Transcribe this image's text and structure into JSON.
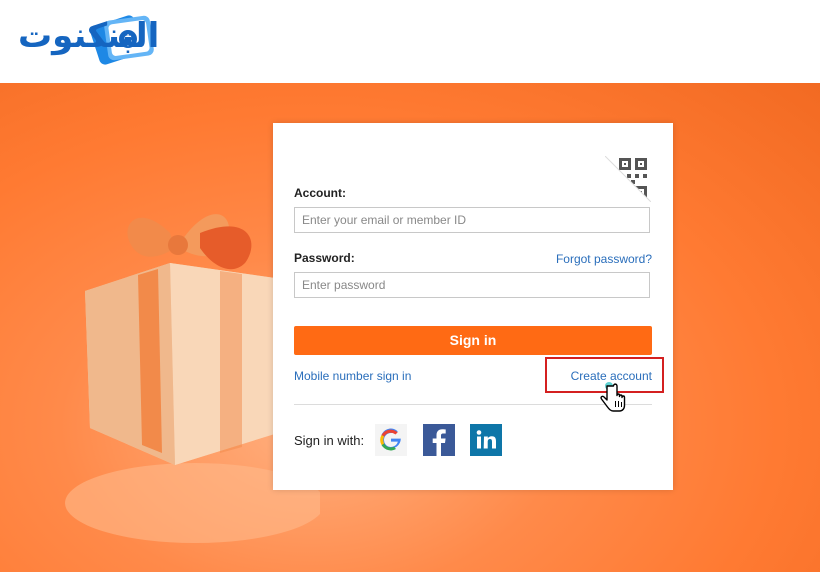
{
  "brand": {
    "logo_text": "البنكنوت",
    "logo_symbol": "$",
    "primary_color": "#1565c0"
  },
  "login": {
    "account_label": "Account:",
    "account_placeholder": "Enter your email or member ID",
    "password_label": "Password:",
    "forgot_password": "Forgot password?",
    "password_placeholder": "Enter password",
    "sign_in_button": "Sign in",
    "mobile_sign_in": "Mobile number sign in",
    "create_account": "Create account",
    "sign_in_with": "Sign in with:",
    "qr_icon": "qr-code-icon"
  },
  "social": [
    {
      "name": "google",
      "glyph": "G"
    },
    {
      "name": "facebook",
      "glyph": "f"
    },
    {
      "name": "linkedin",
      "glyph": "in"
    }
  ],
  "colors": {
    "accent": "#ff6a14",
    "link": "#2a6ebb",
    "highlight_border": "#d42020"
  }
}
